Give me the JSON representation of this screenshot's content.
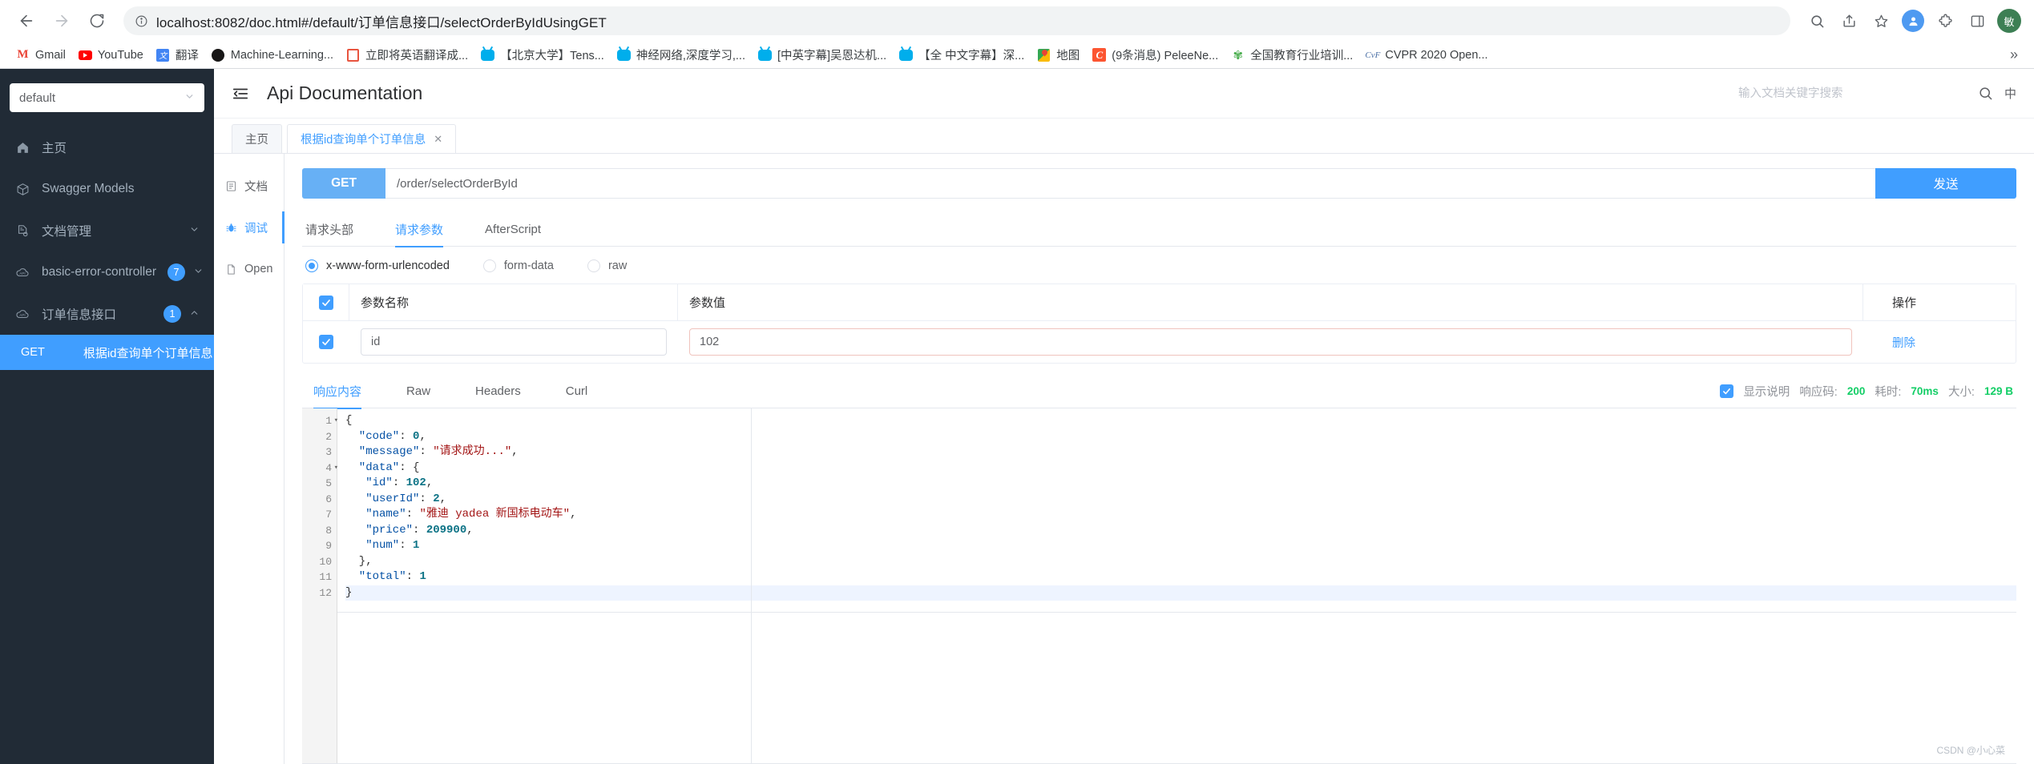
{
  "browser": {
    "back_icon": "back-arrow-icon",
    "forward_icon": "forward-arrow-icon",
    "reload_icon": "reload-icon",
    "url_scheme": "",
    "url": "localhost:8082/doc.html#/default/订单信息接口/selectOrderByIdUsingGET",
    "profile_initial": "敏",
    "overflow": "»",
    "bookmarks": [
      {
        "label": "Gmail",
        "icon": "gmail-icon"
      },
      {
        "label": "YouTube",
        "icon": "youtube-icon"
      },
      {
        "label": "翻译",
        "icon": "google-translate-icon"
      },
      {
        "label": "Machine-Learning...",
        "icon": "github-icon"
      },
      {
        "label": "立即将英语翻译成...",
        "icon": "translate-tool-icon"
      },
      {
        "label": "【北京大学】Tens...",
        "icon": "bilibili-icon"
      },
      {
        "label": "神经网络,深度学习,...",
        "icon": "bilibili-icon"
      },
      {
        "label": "[中英字幕]吴恩达机...",
        "icon": "bilibili-icon"
      },
      {
        "label": "【全 中文字幕】深...",
        "icon": "bilibili-icon"
      },
      {
        "label": "地图",
        "icon": "google-maps-icon"
      },
      {
        "label": "(9条消息) PeleeNe...",
        "icon": "csdn-icon"
      },
      {
        "label": "全国教育行业培训...",
        "icon": "education-icon"
      },
      {
        "label": "CVPR 2020 Open...",
        "icon": "cvf-icon"
      }
    ]
  },
  "sidebar": {
    "select_value": "default",
    "items": [
      {
        "label": "主页",
        "icon": "home-icon",
        "badge": "",
        "chevron": ""
      },
      {
        "label": "Swagger Models",
        "icon": "cube-icon",
        "badge": "",
        "chevron": ""
      },
      {
        "label": "文档管理",
        "icon": "document-settings-icon",
        "badge": "",
        "chevron": "⌄"
      },
      {
        "label": "basic-error-controller",
        "icon": "api-cloud-icon",
        "badge": "7",
        "chevron": "⌄"
      },
      {
        "label": "订单信息接口",
        "icon": "api-cloud-icon",
        "badge": "1",
        "chevron": "⌃"
      }
    ],
    "sub_item": {
      "method": "GET",
      "label": "根据id查询单个订单信息"
    }
  },
  "topbar": {
    "collapse_icon": "collapse-menu-icon",
    "title": "Api Documentation",
    "search_placeholder": "输入文档关键字搜索",
    "search_value": "",
    "search_icon": "search-icon",
    "lang_label": "中"
  },
  "doc_tabs": [
    {
      "label": "主页",
      "closable": false,
      "active": false
    },
    {
      "label": "根据id查询单个订单信息",
      "closable": true,
      "close_label": "✕",
      "active": true
    }
  ],
  "mininav": [
    {
      "label": "文档",
      "icon": "document-icon",
      "active": false
    },
    {
      "label": "调试",
      "icon": "bug-icon",
      "active": true
    },
    {
      "label": "Open",
      "icon": "open-file-icon",
      "active": false
    }
  ],
  "debug": {
    "method": "GET",
    "url": "/order/selectOrderById",
    "send_label": "发送",
    "request_tabs": [
      {
        "label": "请求头部",
        "active": false
      },
      {
        "label": "请求参数",
        "active": true
      },
      {
        "label": "AfterScript",
        "active": false
      }
    ],
    "body_types": [
      {
        "label": "x-www-form-urlencoded",
        "selected": true
      },
      {
        "label": "form-data",
        "selected": false
      },
      {
        "label": "raw",
        "selected": false
      }
    ],
    "param_table": {
      "headers": [
        "参数名称",
        "参数值",
        "操作"
      ],
      "header_checked": true,
      "rows": [
        {
          "checked": true,
          "name": "id",
          "value": "102",
          "action": "删除"
        }
      ]
    },
    "response_tabs": [
      {
        "label": "响应内容",
        "active": true
      },
      {
        "label": "Raw",
        "active": false
      },
      {
        "label": "Headers",
        "active": false
      },
      {
        "label": "Curl",
        "active": false
      }
    ],
    "response_meta": {
      "show_desc_checked": true,
      "show_desc_label": "显示说明",
      "code_label": "响应码:",
      "code_value": "200",
      "time_label": "耗时:",
      "time_value": "70ms",
      "size_label": "大小:",
      "size_value": "129 B"
    },
    "response_code_lines": [
      {
        "n": "1",
        "fold": "▾",
        "segments": [
          {
            "t": "{",
            "c": "p"
          }
        ]
      },
      {
        "n": "2",
        "fold": "",
        "segments": [
          {
            "t": "  \"code\"",
            "c": "k"
          },
          {
            "t": ": ",
            "c": "p"
          },
          {
            "t": "0",
            "c": "n"
          },
          {
            "t": ",",
            "c": "p"
          }
        ]
      },
      {
        "n": "3",
        "fold": "",
        "segments": [
          {
            "t": "  \"message\"",
            "c": "k"
          },
          {
            "t": ": ",
            "c": "p"
          },
          {
            "t": "\"请求成功...\"",
            "c": "s"
          },
          {
            "t": ",",
            "c": "p"
          }
        ]
      },
      {
        "n": "4",
        "fold": "▾",
        "segments": [
          {
            "t": "  \"data\"",
            "c": "k"
          },
          {
            "t": ": {",
            "c": "p"
          }
        ]
      },
      {
        "n": "5",
        "fold": "",
        "segments": [
          {
            "t": "   \"id\"",
            "c": "k"
          },
          {
            "t": ": ",
            "c": "p"
          },
          {
            "t": "102",
            "c": "n"
          },
          {
            "t": ",",
            "c": "p"
          }
        ]
      },
      {
        "n": "6",
        "fold": "",
        "segments": [
          {
            "t": "   \"userId\"",
            "c": "k"
          },
          {
            "t": ": ",
            "c": "p"
          },
          {
            "t": "2",
            "c": "n"
          },
          {
            "t": ",",
            "c": "p"
          }
        ]
      },
      {
        "n": "7",
        "fold": "",
        "segments": [
          {
            "t": "   \"name\"",
            "c": "k"
          },
          {
            "t": ": ",
            "c": "p"
          },
          {
            "t": "\"雅迪 yadea 新国标电动车\"",
            "c": "s"
          },
          {
            "t": ",",
            "c": "p"
          }
        ]
      },
      {
        "n": "8",
        "fold": "",
        "segments": [
          {
            "t": "   \"price\"",
            "c": "k"
          },
          {
            "t": ": ",
            "c": "p"
          },
          {
            "t": "209900",
            "c": "n"
          },
          {
            "t": ",",
            "c": "p"
          }
        ]
      },
      {
        "n": "9",
        "fold": "",
        "segments": [
          {
            "t": "   \"num\"",
            "c": "k"
          },
          {
            "t": ": ",
            "c": "p"
          },
          {
            "t": "1",
            "c": "n"
          }
        ]
      },
      {
        "n": "10",
        "fold": "",
        "segments": [
          {
            "t": "  },",
            "c": "p"
          }
        ]
      },
      {
        "n": "11",
        "fold": "",
        "segments": [
          {
            "t": "  \"total\"",
            "c": "k"
          },
          {
            "t": ": ",
            "c": "p"
          },
          {
            "t": "1",
            "c": "n"
          }
        ]
      },
      {
        "n": "12",
        "fold": "",
        "highlight": true,
        "segments": [
          {
            "t": "}",
            "c": "p"
          }
        ]
      }
    ]
  },
  "watermark": "CSDN @小心菜"
}
